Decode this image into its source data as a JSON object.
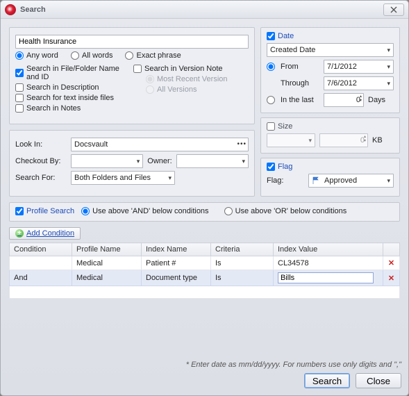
{
  "window": {
    "title": "Search"
  },
  "search": {
    "query": "Health Insurance",
    "match": {
      "any": "Any word",
      "all": "All words",
      "exact": "Exact phrase"
    },
    "scope": {
      "name_id": "Search in File/Folder Name and ID",
      "desc": "Search in Description",
      "fulltext": "Search for text inside files",
      "notes": "Search in Notes",
      "version_note": "Search in Version Note",
      "most_recent": "Most Recent Version",
      "all_versions": "All Versions"
    },
    "lookin_label": "Look In:",
    "lookin_value": "Docsvault",
    "checkout_label": "Checkout By:",
    "owner_label": "Owner:",
    "searchfor_label": "Search For:",
    "searchfor_value": "Both Folders and Files"
  },
  "date": {
    "title": "Date",
    "type": "Created Date",
    "from_label": "From",
    "from_value": "7/1/2012",
    "through_label": "Through",
    "through_value": "7/6/2012",
    "inlast_label": "In the last",
    "inlast_value": "0",
    "inlast_unit": "Days"
  },
  "size": {
    "title": "Size",
    "unit": "KB",
    "value": "0"
  },
  "flag": {
    "title": "Flag",
    "label": "Flag:",
    "value": "Approved"
  },
  "profile": {
    "title": "Profile Search",
    "and_opt": "Use above 'AND' below conditions",
    "or_opt": "Use above 'OR' below conditions",
    "add_label": "Add Condition",
    "cols": {
      "cond": "Condition",
      "profile": "Profile Name",
      "index": "Index Name",
      "criteria": "Criteria",
      "value": "Index Value"
    },
    "rows": [
      {
        "cond": "",
        "profile": "Medical",
        "index": "Patient #",
        "criteria": "Is",
        "value": "CL34578"
      },
      {
        "cond": "And",
        "profile": "Medical",
        "index": "Document type",
        "criteria": "Is",
        "value": "Bills"
      }
    ]
  },
  "footer": {
    "hint": "* Enter date as mm/dd/yyyy. For numbers use only digits and \",\"",
    "search": "Search",
    "close": "Close"
  }
}
